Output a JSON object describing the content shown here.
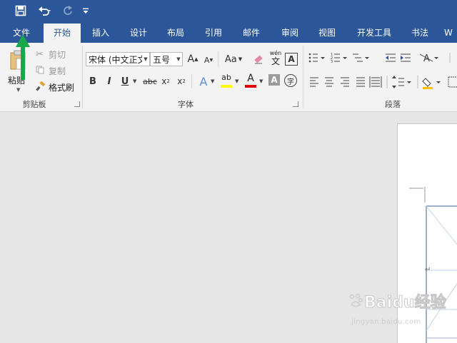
{
  "quick_access": {
    "save_icon": "save-icon",
    "undo_icon": "undo-icon",
    "redo_icon": "redo-icon",
    "customize_icon": "customize-icon"
  },
  "tabs": [
    "文件",
    "开始",
    "插入",
    "设计",
    "布局",
    "引用",
    "邮件",
    "审阅",
    "视图",
    "开发工具",
    "书法",
    "W"
  ],
  "clipboard": {
    "paste": "粘贴",
    "cut": "剪切",
    "copy": "复制",
    "format_painter": "格式刷",
    "group_label": "剪贴板"
  },
  "font": {
    "font_name": "宋体 (中文正文",
    "font_size": "五号",
    "change_case": "Aa",
    "phonetic_top": "wén",
    "phonetic_bottom": "文",
    "char_border": "A",
    "bold": "B",
    "italic": "I",
    "underline": "U",
    "strikethrough": "abc",
    "subscript": "x",
    "subscript_mark": "2",
    "superscript": "x",
    "superscript_mark": "2",
    "enclose_char": "字",
    "grow_font": "A",
    "shrink_font": "A",
    "text_effects": "A",
    "highlight": "ab",
    "font_color": "A",
    "shading": "A",
    "group_label": "字体"
  },
  "paragraph": {
    "group_label": "段落"
  },
  "colors": {
    "accent": "#2b579a",
    "highlight_yellow": "#ffff00",
    "font_color_red": "#e00000",
    "arrow_green": "#17a84b"
  },
  "watermark": {
    "brand": "Baidu经验",
    "url": "jingyan.baidu.com"
  }
}
